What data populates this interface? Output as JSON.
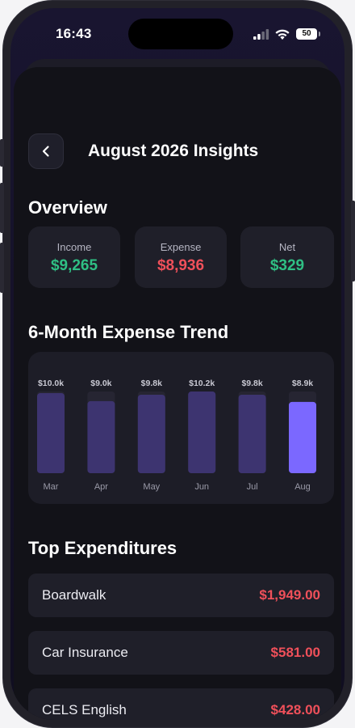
{
  "status_bar": {
    "time": "16:43",
    "battery": "50",
    "icons": [
      "cellular-signal-icon",
      "wifi-icon",
      "battery-icon"
    ]
  },
  "header": {
    "back_icon": "chevron-left-icon",
    "title": "August 2026 Insights"
  },
  "overview": {
    "title": "Overview",
    "cards": [
      {
        "label": "Income",
        "value": "$9,265",
        "color": "#2fbf84"
      },
      {
        "label": "Expense",
        "value": "$8,936",
        "color": "#f0505a"
      },
      {
        "label": "Net",
        "value": "$329",
        "color": "#2fbf84"
      }
    ]
  },
  "trend": {
    "title": "6-Month Expense Trend"
  },
  "chart_data": {
    "type": "bar",
    "categories": [
      "Mar",
      "Apr",
      "May",
      "Jun",
      "Jul",
      "Aug"
    ],
    "values": [
      10.0,
      9.0,
      9.8,
      10.2,
      9.8,
      8.9
    ],
    "value_labels": [
      "$10.0k",
      "$9.0k",
      "$9.8k",
      "$10.2k",
      "$9.8k",
      "$8.9k"
    ],
    "max_value": 10.2,
    "highlight_index": 5,
    "bar_color": "#3d3470",
    "highlight_color": "#7b68ff",
    "track_color": "#262532"
  },
  "expenditures": {
    "title": "Top Expenditures",
    "items": [
      {
        "name": "Boardwalk",
        "amount": "$1,949.00"
      },
      {
        "name": "Car Insurance",
        "amount": "$581.00"
      },
      {
        "name": "CELS English",
        "amount": "$428.00"
      }
    ]
  },
  "colors": {
    "positive": "#2fbf84",
    "negative": "#f0505a",
    "background": "#121218",
    "card": "#1f1f29"
  }
}
